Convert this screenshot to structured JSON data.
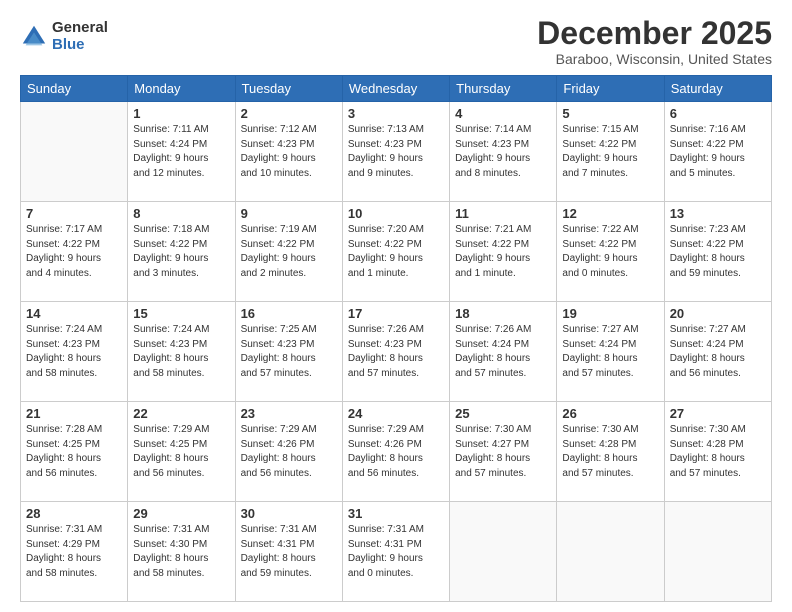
{
  "logo": {
    "general": "General",
    "blue": "Blue"
  },
  "title": "December 2025",
  "location": "Baraboo, Wisconsin, United States",
  "days_header": [
    "Sunday",
    "Monday",
    "Tuesday",
    "Wednesday",
    "Thursday",
    "Friday",
    "Saturday"
  ],
  "weeks": [
    [
      {
        "day": "",
        "info": ""
      },
      {
        "day": "1",
        "info": "Sunrise: 7:11 AM\nSunset: 4:24 PM\nDaylight: 9 hours\nand 12 minutes."
      },
      {
        "day": "2",
        "info": "Sunrise: 7:12 AM\nSunset: 4:23 PM\nDaylight: 9 hours\nand 10 minutes."
      },
      {
        "day": "3",
        "info": "Sunrise: 7:13 AM\nSunset: 4:23 PM\nDaylight: 9 hours\nand 9 minutes."
      },
      {
        "day": "4",
        "info": "Sunrise: 7:14 AM\nSunset: 4:23 PM\nDaylight: 9 hours\nand 8 minutes."
      },
      {
        "day": "5",
        "info": "Sunrise: 7:15 AM\nSunset: 4:22 PM\nDaylight: 9 hours\nand 7 minutes."
      },
      {
        "day": "6",
        "info": "Sunrise: 7:16 AM\nSunset: 4:22 PM\nDaylight: 9 hours\nand 5 minutes."
      }
    ],
    [
      {
        "day": "7",
        "info": "Sunrise: 7:17 AM\nSunset: 4:22 PM\nDaylight: 9 hours\nand 4 minutes."
      },
      {
        "day": "8",
        "info": "Sunrise: 7:18 AM\nSunset: 4:22 PM\nDaylight: 9 hours\nand 3 minutes."
      },
      {
        "day": "9",
        "info": "Sunrise: 7:19 AM\nSunset: 4:22 PM\nDaylight: 9 hours\nand 2 minutes."
      },
      {
        "day": "10",
        "info": "Sunrise: 7:20 AM\nSunset: 4:22 PM\nDaylight: 9 hours\nand 1 minute."
      },
      {
        "day": "11",
        "info": "Sunrise: 7:21 AM\nSunset: 4:22 PM\nDaylight: 9 hours\nand 1 minute."
      },
      {
        "day": "12",
        "info": "Sunrise: 7:22 AM\nSunset: 4:22 PM\nDaylight: 9 hours\nand 0 minutes."
      },
      {
        "day": "13",
        "info": "Sunrise: 7:23 AM\nSunset: 4:22 PM\nDaylight: 8 hours\nand 59 minutes."
      }
    ],
    [
      {
        "day": "14",
        "info": "Sunrise: 7:24 AM\nSunset: 4:23 PM\nDaylight: 8 hours\nand 58 minutes."
      },
      {
        "day": "15",
        "info": "Sunrise: 7:24 AM\nSunset: 4:23 PM\nDaylight: 8 hours\nand 58 minutes."
      },
      {
        "day": "16",
        "info": "Sunrise: 7:25 AM\nSunset: 4:23 PM\nDaylight: 8 hours\nand 57 minutes."
      },
      {
        "day": "17",
        "info": "Sunrise: 7:26 AM\nSunset: 4:23 PM\nDaylight: 8 hours\nand 57 minutes."
      },
      {
        "day": "18",
        "info": "Sunrise: 7:26 AM\nSunset: 4:24 PM\nDaylight: 8 hours\nand 57 minutes."
      },
      {
        "day": "19",
        "info": "Sunrise: 7:27 AM\nSunset: 4:24 PM\nDaylight: 8 hours\nand 57 minutes."
      },
      {
        "day": "20",
        "info": "Sunrise: 7:27 AM\nSunset: 4:24 PM\nDaylight: 8 hours\nand 56 minutes."
      }
    ],
    [
      {
        "day": "21",
        "info": "Sunrise: 7:28 AM\nSunset: 4:25 PM\nDaylight: 8 hours\nand 56 minutes."
      },
      {
        "day": "22",
        "info": "Sunrise: 7:29 AM\nSunset: 4:25 PM\nDaylight: 8 hours\nand 56 minutes."
      },
      {
        "day": "23",
        "info": "Sunrise: 7:29 AM\nSunset: 4:26 PM\nDaylight: 8 hours\nand 56 minutes."
      },
      {
        "day": "24",
        "info": "Sunrise: 7:29 AM\nSunset: 4:26 PM\nDaylight: 8 hours\nand 56 minutes."
      },
      {
        "day": "25",
        "info": "Sunrise: 7:30 AM\nSunset: 4:27 PM\nDaylight: 8 hours\nand 57 minutes."
      },
      {
        "day": "26",
        "info": "Sunrise: 7:30 AM\nSunset: 4:28 PM\nDaylight: 8 hours\nand 57 minutes."
      },
      {
        "day": "27",
        "info": "Sunrise: 7:30 AM\nSunset: 4:28 PM\nDaylight: 8 hours\nand 57 minutes."
      }
    ],
    [
      {
        "day": "28",
        "info": "Sunrise: 7:31 AM\nSunset: 4:29 PM\nDaylight: 8 hours\nand 58 minutes."
      },
      {
        "day": "29",
        "info": "Sunrise: 7:31 AM\nSunset: 4:30 PM\nDaylight: 8 hours\nand 58 minutes."
      },
      {
        "day": "30",
        "info": "Sunrise: 7:31 AM\nSunset: 4:31 PM\nDaylight: 8 hours\nand 59 minutes."
      },
      {
        "day": "31",
        "info": "Sunrise: 7:31 AM\nSunset: 4:31 PM\nDaylight: 9 hours\nand 0 minutes."
      },
      {
        "day": "",
        "info": ""
      },
      {
        "day": "",
        "info": ""
      },
      {
        "day": "",
        "info": ""
      }
    ]
  ]
}
